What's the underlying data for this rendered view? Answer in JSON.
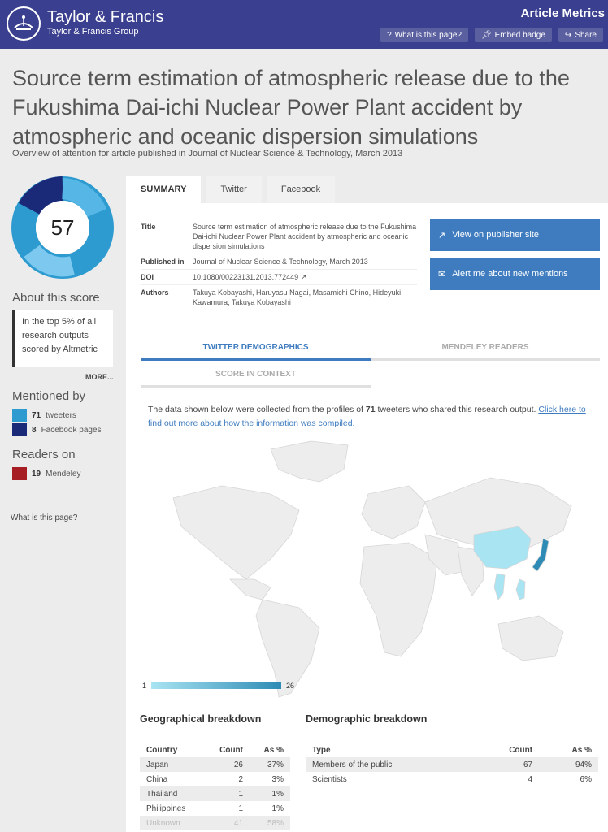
{
  "header": {
    "brand_name": "Taylor & Francis",
    "brand_sub": "Taylor & Francis Group",
    "metrics_title": "Article Metrics",
    "buttons": [
      {
        "icon": "question-icon",
        "label": "What is this page?"
      },
      {
        "icon": "pin-icon",
        "label": "Embed badge"
      },
      {
        "icon": "share-icon",
        "label": "Share"
      }
    ],
    "bg_color": "#3a3f8f"
  },
  "article": {
    "title": "Source term estimation of atmospheric release due to the Fukushima Dai-ichi Nuclear Power Plant accident by atmospheric and oceanic dispersion simulations",
    "subtitle": "Overview of attention for article published in Journal of Nuclear Science & Technology, March 2013"
  },
  "score": {
    "value": "57",
    "about_heading": "About this score",
    "top_text": "In the top 5% of all research outputs scored by Altmetric",
    "more_label": "MORE...",
    "mentioned_heading": "Mentioned by",
    "mentions": [
      {
        "count": "71",
        "label": "tweeters",
        "color": "#2e9bd0"
      },
      {
        "count": "8",
        "label": "Facebook pages",
        "color": "#1a2a78"
      }
    ],
    "readers_heading": "Readers on",
    "readers": [
      {
        "count": "19",
        "label": "Mendeley",
        "color": "#a61d24"
      }
    ],
    "what_link": "What is this page?"
  },
  "tabs": [
    "SUMMARY",
    "Twitter",
    "Facebook"
  ],
  "details": {
    "rows": [
      {
        "label": "Title",
        "value": "Source term estimation of atmospheric release due to the Fukushima Dai-ichi Nuclear Power Plant accident by atmospheric and oceanic dispersion simulations"
      },
      {
        "label": "Published in",
        "value": "Journal of Nuclear Science & Technology, March 2013"
      },
      {
        "label": "DOI",
        "value": "10.1080/00223131.2013.772449"
      },
      {
        "label": "Authors",
        "value": "Takuya Kobayashi, Haruyasu Nagai, Masamichi Chino, Hideyuki Kawamura, Takuya Kobayashi"
      }
    ]
  },
  "actions": {
    "publisher_label": "View on publisher site",
    "alert_label": "Alert me about new mentions",
    "color": "#3f7cbf"
  },
  "subtabs": [
    "TWITTER DEMOGRAPHICS",
    "MENDELEY READERS",
    "SCORE IN CONTEXT"
  ],
  "demographics": {
    "text_before": "The data shown below were collected from the profiles of ",
    "count": "71",
    "text_after": " tweeters who shared this research output. ",
    "link": "Click here to find out more about how the information was compiled.",
    "scale_min": "1",
    "scale_max": "26"
  },
  "geo": {
    "heading": "Geographical breakdown",
    "columns": [
      "Country",
      "Count",
      "As %"
    ],
    "rows": [
      [
        "Japan",
        "26",
        "37%"
      ],
      [
        "China",
        "2",
        "3%"
      ],
      [
        "Thailand",
        "1",
        "1%"
      ],
      [
        "Philippines",
        "1",
        "1%"
      ],
      [
        "Unknown",
        "41",
        "58%"
      ]
    ]
  },
  "demo": {
    "heading": "Demographic breakdown",
    "columns": [
      "Type",
      "Count",
      "As %"
    ],
    "rows": [
      [
        "Members of the public",
        "67",
        "94%"
      ],
      [
        "Scientists",
        "4",
        "6%"
      ]
    ]
  }
}
